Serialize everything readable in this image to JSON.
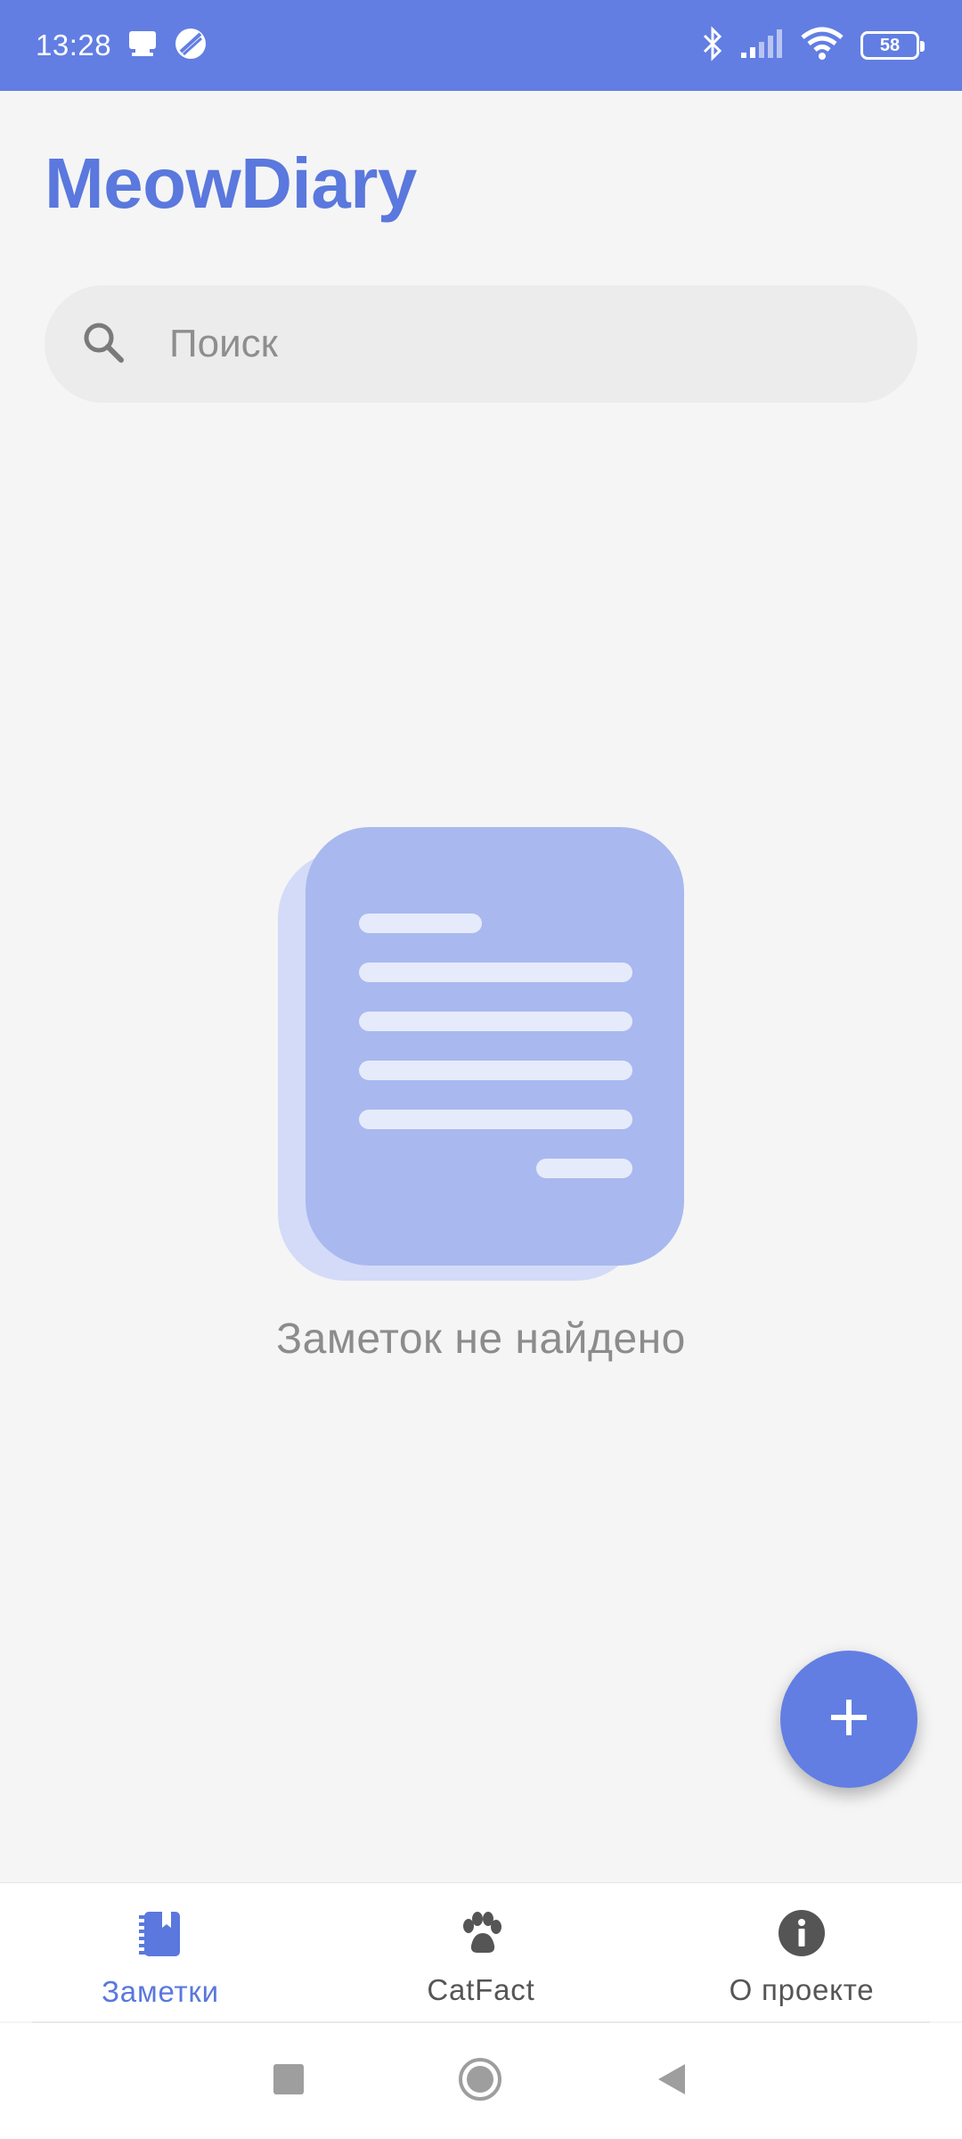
{
  "status_bar": {
    "time": "13:28",
    "battery_level": "58",
    "icons": [
      "notification-icon",
      "vpn-icon",
      "bluetooth-icon",
      "signal-icon",
      "wifi-icon",
      "battery-icon"
    ]
  },
  "app": {
    "title": "MeowDiary"
  },
  "search": {
    "placeholder": "Поиск",
    "value": ""
  },
  "empty_state": {
    "message": "Заметок не найдено",
    "icon": "document-icon"
  },
  "fab": {
    "icon": "plus-icon"
  },
  "bottom_nav": {
    "items": [
      {
        "label": "Заметки",
        "icon": "notebook-icon",
        "active": true
      },
      {
        "label": "CatFact",
        "icon": "paw-icon",
        "active": false
      },
      {
        "label": "О проекте",
        "icon": "info-icon",
        "active": false
      }
    ]
  },
  "system_nav": {
    "buttons": [
      "recents-button",
      "home-button",
      "back-button"
    ]
  },
  "colors": {
    "accent": "#627ee3",
    "background": "#f5f5f5",
    "illustration": "#a9b8ef",
    "illustration_back": "#d3dbf8"
  }
}
